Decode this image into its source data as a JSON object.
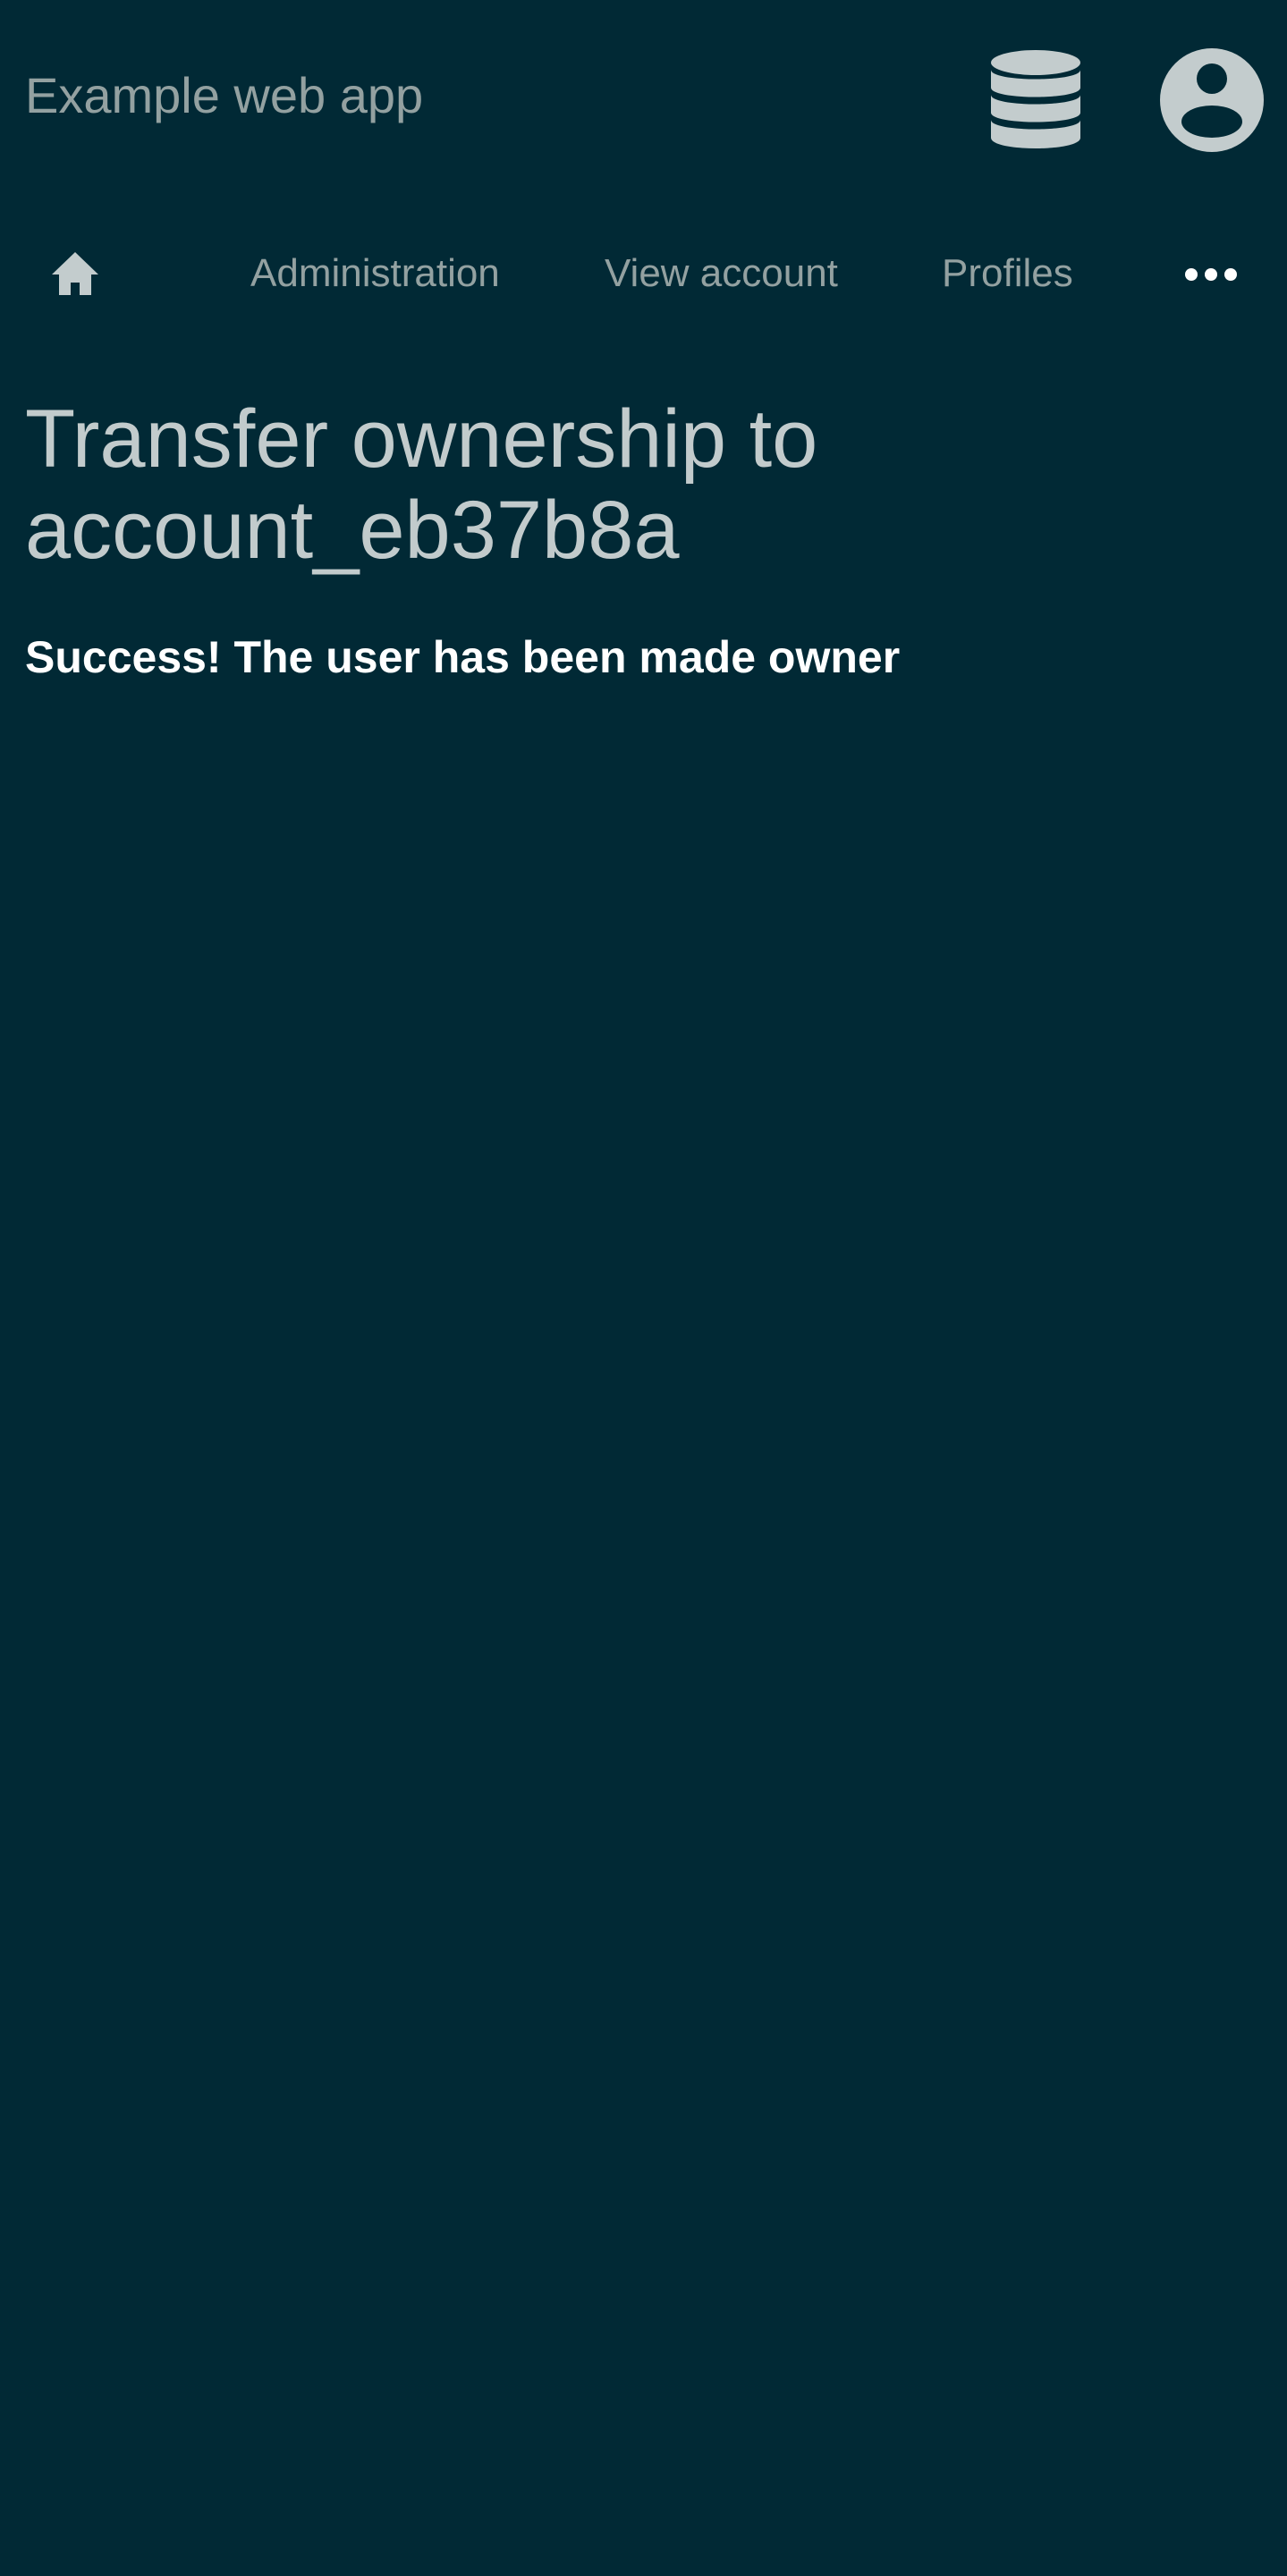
{
  "header": {
    "app_title": "Example web app",
    "database_icon": "database-icon",
    "user_icon": "user-circle-icon"
  },
  "nav": {
    "home_icon": "home-icon",
    "items": [
      {
        "label": "Administration"
      },
      {
        "label": "View account"
      },
      {
        "label": "Profiles"
      }
    ],
    "more_icon": "more-horizontal-icon"
  },
  "main": {
    "title": "Transfer ownership to account_eb37b8a",
    "message": "Success! The user has been made owner"
  },
  "colors": {
    "background": "#012935",
    "muted_text": "#93a1a1",
    "title_text": "#c2cbcc",
    "icon": "#c3cccd",
    "message_text": "#ffffff"
  }
}
